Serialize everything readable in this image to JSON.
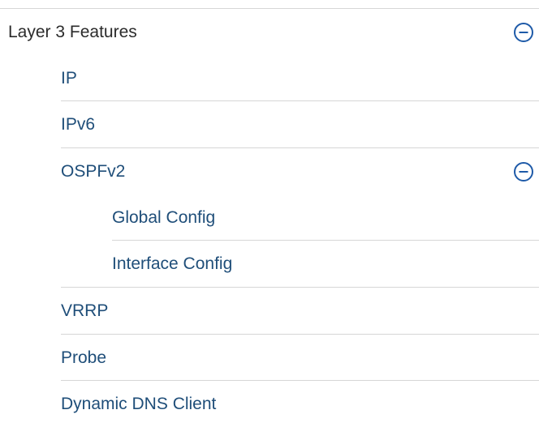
{
  "nav": {
    "layer3": {
      "label": "Layer 3 Features",
      "collapse_icon": "minus-circle-icon",
      "items": {
        "ip": "IP",
        "ipv6": "IPv6",
        "ospfv2": {
          "label": "OSPFv2",
          "collapse_icon": "minus-circle-icon",
          "children": {
            "global_config": "Global Config",
            "interface_config": "Interface Config"
          }
        },
        "vrrp": "VRRP",
        "probe": "Probe",
        "dynamic_dns_client": "Dynamic DNS Client"
      }
    }
  },
  "colors": {
    "item_text": "#1f4e79",
    "section_text": "#2b2b2b",
    "icon": "#1e5aa8",
    "divider": "#d6d6d6"
  }
}
